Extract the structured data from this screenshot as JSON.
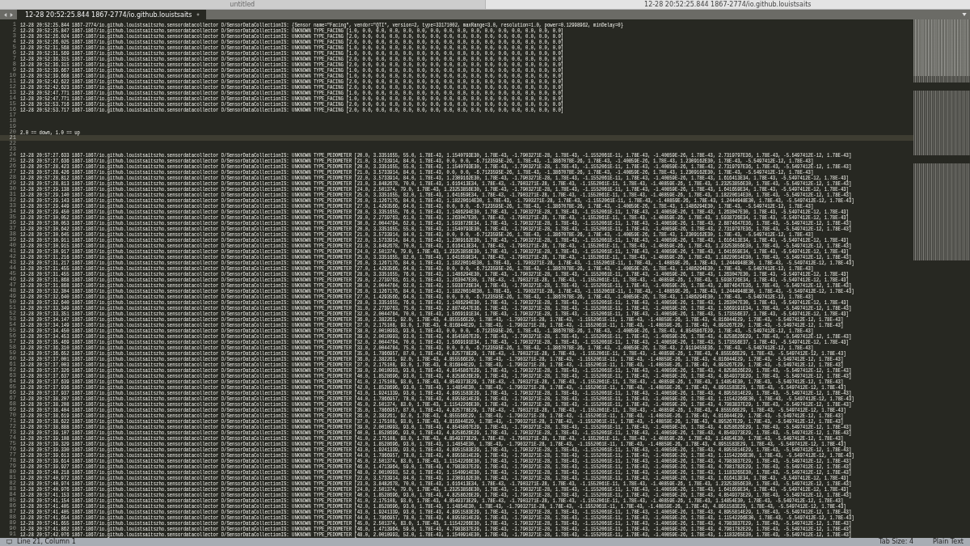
{
  "window_tabs": [
    {
      "title": "untitled",
      "selected": false
    },
    {
      "title": "12-28 20:52:25.844 1867-2774/io.github.louistsaits",
      "selected": true
    }
  ],
  "editor_tabs": [
    {
      "label": "12-28 20:52:25.844 1867-2774/io.github.louistsaits",
      "selected": true,
      "modified": true
    }
  ],
  "lines": [
    {
      "n": "1",
      "current": false,
      "text": "12-28 20:52:25.844 1867-2774/io.github.louistsaitszho.sensordatacollector D/SensorDataCollectionIS: {Sensor name=\"Facing\", vendor=\"QTI\", version=2, type=33171002, maxRange=3.0, resolution=1.0, power=0.12998962, minDelay=0}"
    },
    {
      "n": "2",
      "current": false,
      "text": "12-28 20:52:25.847 1867-1867/io.github.louistsaitszho.sensordatacollector D/SensorDataCollectionIS: UNKNOWN TYPE_FACING [1.0, 0.0, 0.0, 0.0, 0.0, 0.0, 0.0, 0.0, 0.0, 0.0, 0.0, 0.0, 0.0, 0.0, 0.0, 0.0]"
    },
    {
      "n": "3",
      "current": false,
      "text": "12-28 20:52:26.024 1867-1867/io.github.louistsaitszho.sensordatacollector D/SensorDataCollectionIS: UNKNOWN TYPE_FACING [2.0, 0.0, 0.0, 0.0, 0.0, 0.0, 0.0, 0.0, 0.0, 0.0, 0.0, 0.0, 0.0, 0.0, 0.0, 0.0]"
    },
    {
      "n": "4",
      "current": false,
      "text": "12-28 20:52:26.025 1867-1867/io.github.louistsaitszho.sensordatacollector D/SensorDataCollectionIS: UNKNOWN TYPE_FACING [2.0, 0.0, 0.0, 0.0, 0.0, 0.0, 0.0, 0.0, 0.0, 0.0, 0.0, 0.0, 0.0, 0.0, 0.0, 0.0]"
    },
    {
      "n": "5",
      "current": false,
      "text": "12-28 20:52:31.568 1867-1867/io.github.louistsaitszho.sensordatacollector D/SensorDataCollectionIS: UNKNOWN TYPE_FACING [1.0, 0.0, 0.0, 0.0, 0.0, 0.0, 0.0, 0.0, 0.0, 0.0, 0.0, 0.0, 0.0, 0.0, 0.0, 0.0]"
    },
    {
      "n": "6",
      "current": false,
      "text": "12-28 20:52:31.569 1867-1867/io.github.louistsaitszho.sensordatacollector D/SensorDataCollectionIS: UNKNOWN TYPE_FACING [1.0, 0.0, 0.0, 0.0, 0.0, 0.0, 0.0, 0.0, 0.0, 0.0, 0.0, 0.0, 0.0, 0.0, 0.0, 0.0]"
    },
    {
      "n": "7",
      "current": false,
      "text": "12-28 20:52:36.315 1867-1867/io.github.louistsaitszho.sensordatacollector D/SensorDataCollectionIS: UNKNOWN TYPE_FACING [2.0, 0.0, 0.0, 0.0, 0.0, 0.0, 0.0, 0.0, 0.0, 0.0, 0.0, 0.0, 0.0, 0.0, 0.0, 0.0]"
    },
    {
      "n": "8",
      "current": false,
      "text": "12-28 20:52:36.315 1867-1867/io.github.louistsaitszho.sensordatacollector D/SensorDataCollectionIS: UNKNOWN TYPE_FACING [2.0, 0.0, 0.0, 0.0, 0.0, 0.0, 0.0, 0.0, 0.0, 0.0, 0.0, 0.0, 0.0, 0.0, 0.0, 0.0]"
    },
    {
      "n": "9",
      "current": false,
      "text": "12-28 20:52:39.667 1867-1867/io.github.louistsaitszho.sensordatacollector D/SensorDataCollectionIS: UNKNOWN TYPE_FACING [1.0, 0.0, 0.0, 0.0, 0.0, 0.0, 0.0, 0.0, 0.0, 0.0, 0.0, 0.0, 0.0, 0.0, 0.0, 0.0]"
    },
    {
      "n": "10",
      "current": false,
      "text": "12-28 20:52:39.668 1867-1867/io.github.louistsaitszho.sensordatacollector D/SensorDataCollectionIS: UNKNOWN TYPE_FACING [1.0, 0.0, 0.0, 0.0, 0.0, 0.0, 0.0, 0.0, 0.0, 0.0, 0.0, 0.0, 0.0, 0.0, 0.0, 0.0]"
    },
    {
      "n": "11",
      "current": false,
      "text": "12-28 20:52:42.622 1867-1867/io.github.louistsaitszho.sensordatacollector D/SensorDataCollectionIS: UNKNOWN TYPE_FACING [2.0, 0.0, 0.0, 0.0, 0.0, 0.0, 0.0, 0.0, 0.0, 0.0, 0.0, 0.0, 0.0, 0.0, 0.0, 0.0]"
    },
    {
      "n": "12",
      "current": false,
      "text": "12-28 20:52:42.623 1867-1867/io.github.louistsaitszho.sensordatacollector D/SensorDataCollectionIS: UNKNOWN TYPE_FACING [2.0, 0.0, 0.0, 0.0, 0.0, 0.0, 0.0, 0.0, 0.0, 0.0, 0.0, 0.0, 0.0, 0.0, 0.0, 0.0]"
    },
    {
      "n": "13",
      "current": false,
      "text": "12-28 20:52:47.771 1867-1867/io.github.louistsaitszho.sensordatacollector D/SensorDataCollectionIS: UNKNOWN TYPE_FACING [1.0, 0.0, 0.0, 0.0, 0.0, 0.0, 0.0, 0.0, 0.0, 0.0, 0.0, 0.0, 0.0, 0.0, 0.0, 0.0]"
    },
    {
      "n": "14",
      "current": false,
      "text": "12-28 20:52:47.771 1867-1867/io.github.louistsaitszho.sensordatacollector D/SensorDataCollectionIS: UNKNOWN TYPE_FACING [1.0, 0.0, 0.0, 0.0, 0.0, 0.0, 0.0, 0.0, 0.0, 0.0, 0.0, 0.0, 0.0, 0.0, 0.0, 0.0]"
    },
    {
      "n": "15",
      "current": false,
      "text": "12-28 20:52:53.716 1867-1867/io.github.louistsaitszho.sensordatacollector D/SensorDataCollectionIS: UNKNOWN TYPE_FACING [2.0, 0.0, 0.0, 0.0, 0.0, 0.0, 0.0, 0.0, 0.0, 0.0, 0.0, 0.0, 0.0, 0.0, 0.0, 0.0]"
    },
    {
      "n": "16",
      "current": false,
      "text": "12-28 20:52:53.717 1867-1867/io.github.louistsaitszho.sensordatacollector D/SensorDataCollectionIS: UNKNOWN TYPE_FACING [2.0, 0.0, 0.0, 0.0, 0.0, 0.0, 0.0, 0.0, 0.0, 0.0, 0.0, 0.0, 0.0, 0.0, 0.0, 0.0]"
    },
    {
      "n": "17",
      "current": false
    },
    {
      "n": "18",
      "current": false
    },
    {
      "n": "19",
      "current": false
    },
    {
      "n": "20",
      "current": false,
      "text": "2.0 == down, 1.0 == up"
    },
    {
      "n": "21",
      "current": true
    },
    {
      "n": "22",
      "current": false
    },
    {
      "n": "23",
      "current": false
    },
    {
      "n": "24",
      "current": false,
      "text": "12-28 20:57:27.633 1867-1867/io.github.louistsaitszho.sensordatacollector D/SensorDataCollectionIS: UNKNOWN TYPE_PEDOMETER [20.0, 3.3351655, 55.0, 1.78E-43, 1.1540793E30, 1.78E-43, -1.7903271E-28, 1.78E-43, -1.1552061E-11, 1.78E-43, -1.40859E-26, 1.78E-43, 2.7319797E36, 1.78E-43, -5.5497412E-12, 1.78E-43]"
    },
    {
      "n": "25",
      "current": false,
      "text": "12-28 20:57:27.636 1867-1867/io.github.louistsaitszho.sensordatacollector D/SensorDataCollectionIS: UNKNOWN TYPE_PEDOMETER [21.0, 3.5733914, 84.0, 1.78E-43, 0.0, 0.0, -6.7123595E-26, 1.78E-43, -1.3867078E-26, 1.78E-43, -1.40859E-26, 1.78E-43, 1.2309162E30, 1.78E-43, -5.5497412E-12, 1.78E-43]"
    },
    {
      "n": "26",
      "current": false,
      "text": "12-28 20:57:28.423 1867-1867/io.github.louistsaitszho.sensordatacollector D/SensorDataCollectionIS: UNKNOWN TYPE_PEDOMETER [20.0, 3.3351655, 55.0, 1.78E-43, 1.1540793E30, 1.78E-43, -1.7903271E-28, 1.78E-43, -1.1552061E-11, 1.78E-43, -1.40859E-26, 1.78E-43, 2.7319797E36, 1.78E-43, -5.5497412E-12, 1.78E-43]"
    },
    {
      "n": "27",
      "current": false,
      "text": "12-28 20:57:28.426 1867-1867/io.github.louistsaitszho.sensordatacollector D/SensorDataCollectionIS: UNKNOWN TYPE_PEDOMETER [21.0, 3.5733914, 84.0, 1.78E-43, 0.0, 0.0, -6.7123595E-26, 1.78E-43, -1.3867078E-26, 1.78E-43, -1.40859E-26, 1.78E-43, 1.2309162E30, 1.78E-43, -5.5497412E-12, 1.78E-43]"
    },
    {
      "n": "28",
      "current": false,
      "text": "12-28 20:57:28.812 1867-1867/io.github.louistsaitszho.sensordatacollector D/SensorDataCollectionIS: UNKNOWN TYPE_PEDOMETER [22.0, 3.5733914, 84.0, 1.78E-43, 1.2309162E30, 1.78E-43, -1.7903271E-28, 1.78E-43, -1.1552061E-11, 1.78E-43, -1.40859E-26, 1.78E-43, 1.616413E34, 1.78E-43, -5.5497412E-12, 1.78E-43]"
    },
    {
      "n": "29",
      "current": false,
      "text": "12-28 20:57:28.813 1867-1867/io.github.louistsaitszho.sensordatacollector D/SensorDataCollectionIS: UNKNOWN TYPE_PEDOMETER [23.0, 3.8482678, 70.0, 1.78E-43, 1.616413E34, 1.78E-43, -1.7903271E-28, 1.78E-43, -1.1552061E-11, 1.78E-43, -1.40859E-26, 1.78E-43, 1.23253856E30, 1.78E-43, -5.5497412E-12, 1.78E-43]"
    },
    {
      "n": "30",
      "current": false,
      "text": "12-28 20:57:29.138 1867-1867/io.github.louistsaitszho.sensordatacollector D/SensorDataCollectionIS: UNKNOWN TYPE_PEDOMETER [24.0, 2.501374, 79.0, 1.78E-43, 1.23253856E30, 1.78E-43, -1.7903271E-28, 1.78E-43, -1.1552061E-11, 1.78E-43, -1.40859E-26, 1.78E-43, 1.641659E34, 1.78E-43, -5.5497412E-12, 1.78E-43]"
    },
    {
      "n": "31",
      "current": false,
      "text": "12-28 20:57:29.140 1867-1867/io.github.louistsaitszho.sensordatacollector D/SensorDataCollectionIS: UNKNOWN TYPE_PEDOMETER [25.0, 3.3351655, 82.0, 1.78E-43, 1.641659E34, 1.78E-43, -1.7903271E-28, 1.78E-43, -1.1552061E-11, 1.78E-43, -1.40859E-26, 1.78E-43, 1.18220614E30, 1.78E-43, -5.5497412E-12, 1.78E-43]"
    },
    {
      "n": "32",
      "current": false,
      "text": "12-28 20:57:29.143 1867-1867/io.github.louistsaitszho.sensordatacollector D/SensorDataCollectionIS: UNKNOWN TYPE_PEDOMETER [26.0, 3.1267176, 84.0, 1.78E-43, 1.18220614E30, 1.78E-43, -1.7903271E-28, 1.78E-43, -1.1552061E-11, 1.78E-43, -1.40859E-26, 1.78E-43, 1.2444948E30, 1.78E-43, -5.5497412E-12, 1.78E-43]"
    },
    {
      "n": "33",
      "current": false,
      "text": "12-28 20:57:29.449 1867-1867/io.github.louistsaitszho.sensordatacollector D/SensorDataCollectionIS: UNKNOWN TYPE_PEDOMETER [27.0, 1.4293566, 64.0, 1.78E-43, 0.0, 0.0, -6.7123595E-26, 1.78E-43, -1.3867078E-26, 1.78E-43, -1.40859E-26, 1.78E-43, 1.1486294E30, 1.78E-43, -5.5497412E-12, 1.78E-43]"
    },
    {
      "n": "34",
      "current": false,
      "text": "12-28 20:57:29.450 1867-1867/io.github.louistsaitszho.sensordatacollector D/SensorDataCollectionIS: UNKNOWN TYPE_PEDOMETER [28.0, 3.3351655, 76.0, 1.78E-43, 1.1486294E30, 1.78E-43, -1.7903271E-28, 1.78E-43, -1.1552061E-11, 1.78E-43, -1.40859E-26, 1.78E-43, 1.263047E30, 1.78E-43, -5.5497412E-12, 1.78E-43]"
    },
    {
      "n": "35",
      "current": false,
      "text": "12-28 20:57:30.052 1867-1867/io.github.louistsaitszho.sensordatacollector D/SensorDataCollectionIS: UNKNOWN TYPE_PEDOMETER [29.0, 2.2739763, 61.0, 1.78E-43, 1.263047E30, 1.78E-43, -1.7903271E-28, 1.78E-43, -1.1552061E-11, 1.78E-43, -1.40859E-26, 1.78E-43, 1.5938726E34, 1.78E-43, -5.5497412E-12, 1.78E-43]"
    },
    {
      "n": "36",
      "current": false,
      "text": "12-28 20:57:30.053 1867-1867/io.github.louistsaitszho.sensordatacollector D/SensorDataCollectionIS: UNKNOWN TYPE_PEDOMETER [30.0, 2.0044784, 62.0, 1.78E-43, 1.5938726E34, 1.78E-43, -1.7903271E-28, 1.78E-43, -1.1552061E-11, 1.78E-43, -1.40859E-26, 1.78E-43, 2.8874647E36, 1.78E-43, -5.5497412E-12, 1.78E-43]"
    },
    {
      "n": "37",
      "current": false,
      "text": "12-28 20:57:30.642 1867-1867/io.github.louistsaitszho.sensordatacollector D/SensorDataCollectionIS: UNKNOWN TYPE_PEDOMETER [20.0, 3.3351655, 55.0, 1.78E-43, 1.1540793E30, 1.78E-43, -1.7903271E-28, 1.78E-43, -1.1552061E-11, 1.78E-43, -1.40859E-26, 1.78E-43, 2.7319797E36, 1.78E-43, -5.5497412E-12, 1.78E-43]"
    },
    {
      "n": "38",
      "current": false,
      "text": "12-28 20:57:30.645 1867-1867/io.github.louistsaitszho.sensordatacollector D/SensorDataCollectionIS: UNKNOWN TYPE_PEDOMETER [21.0, 3.5733914, 84.0, 1.78E-43, 0.0, 0.0, -6.7123595E-26, 1.78E-43, -1.3867078E-26, 1.78E-43, -1.40859E-26, 1.78E-43, 1.2309162E30, 1.78E-43, -5.5497412E-12, 1.78E-43]"
    },
    {
      "n": "39",
      "current": false,
      "text": "12-28 20:57:30.911 1867-1867/io.github.louistsaitszho.sensordatacollector D/SensorDataCollectionIS: UNKNOWN TYPE_PEDOMETER [22.0, 3.5733914, 84.0, 1.78E-43, 1.2309162E30, 1.78E-43, -1.7903271E-28, 1.78E-43, -1.1552061E-11, 1.78E-43, -1.40859E-26, 1.78E-43, 1.616413E34, 1.78E-43, -5.5497412E-12, 1.78E-43]"
    },
    {
      "n": "40",
      "current": false,
      "text": "12-28 20:57:30.915 1867-1867/io.github.louistsaitszho.sensordatacollector D/SensorDataCollectionIS: UNKNOWN TYPE_PEDOMETER [23.0, 3.8482678, 70.0, 1.78E-43, 1.616413E34, 1.78E-43, -1.7903271E-28, 1.78E-43, -1.1552061E-11, 1.78E-43, -1.40859E-26, 1.78E-43, 1.23253856E30, 1.78E-43, -5.5497412E-12, 1.78E-43]"
    },
    {
      "n": "41",
      "current": false,
      "text": "12-28 20:57:30.917 1867-1867/io.github.louistsaitszho.sensordatacollector D/SensorDataCollectionIS: UNKNOWN TYPE_PEDOMETER [24.0, 2.501374, 79.0, 1.78E-43, 1.23253856E30, 1.78E-43, -1.7903271E-28, 1.78E-43, -1.1552061E-11, 1.78E-43, -1.40859E-26, 1.78E-43, 1.641659E34, 1.78E-43, -5.5497412E-12, 1.78E-43]"
    },
    {
      "n": "42",
      "current": false,
      "text": "12-28 20:57:31.216 1867-1867/io.github.louistsaitszho.sensordatacollector D/SensorDataCollectionIS: UNKNOWN TYPE_PEDOMETER [25.0, 3.3351655, 82.0, 1.78E-43, 1.641659E34, 1.78E-43, -1.7903271E-28, 1.78E-43, -1.1552061E-11, 1.78E-43, -1.40859E-26, 1.78E-43, 1.18220614E30, 1.78E-43, -5.5497412E-12, 1.78E-43]"
    },
    {
      "n": "43",
      "current": false,
      "text": "12-28 20:57:31.217 1867-1867/io.github.louistsaitszho.sensordatacollector D/SensorDataCollectionIS: UNKNOWN TYPE_PEDOMETER [26.0, 3.1267176, 84.0, 1.78E-43, 1.18220614E30, 1.78E-43, -1.7903271E-28, 1.78E-43, -1.1552061E-11, 1.78E-43, -1.40859E-26, 1.78E-43, 1.2444948E30, 1.78E-43, -5.5497412E-12, 1.78E-43]"
    },
    {
      "n": "44",
      "current": false,
      "text": "12-28 20:57:31.455 1867-1867/io.github.louistsaitszho.sensordatacollector D/SensorDataCollectionIS: UNKNOWN TYPE_PEDOMETER [27.0, 1.4293566, 64.0, 1.78E-43, 0.0, 0.0, -6.7123595E-26, 1.78E-43, -1.3867078E-26, 1.78E-43, -1.40859E-26, 1.78E-43, 1.1486294E30, 1.78E-43, -5.5497412E-12, 1.78E-43]"
    },
    {
      "n": "45",
      "current": false,
      "text": "12-28 20:57:31.455 1867-1867/io.github.louistsaitszho.sensordatacollector D/SensorDataCollectionIS: UNKNOWN TYPE_PEDOMETER [28.0, 3.3351655, 76.0, 1.78E-43, 1.1486294E30, 1.78E-43, -1.7903271E-28, 1.78E-43, -1.1552061E-11, 1.78E-43, -1.40859E-26, 1.78E-43, 1.263047E30, 1.78E-43, -5.5497412E-12, 1.78E-43]"
    },
    {
      "n": "46",
      "current": false,
      "text": "12-28 20:57:31.868 1867-1867/io.github.louistsaitszho.sensordatacollector D/SensorDataCollectionIS: UNKNOWN TYPE_PEDOMETER [29.0, 2.2739763, 61.0, 1.78E-43, 1.263047E30, 1.78E-43, -1.7903271E-28, 1.78E-43, -1.1552061E-11, 1.78E-43, -1.40859E-26, 1.78E-43, 1.5938726E34, 1.78E-43, -5.5497412E-12, 1.78E-43]"
    },
    {
      "n": "47",
      "current": false,
      "text": "12-28 20:57:31.868 1867-1867/io.github.louistsaitszho.sensordatacollector D/SensorDataCollectionIS: UNKNOWN TYPE_PEDOMETER [30.0, 2.0044784, 62.0, 1.78E-43, 1.5938726E34, 1.78E-43, -1.7903271E-28, 1.78E-43, -1.1552061E-11, 1.78E-43, -1.40859E-26, 1.78E-43, 2.8874647E36, 1.78E-43, -5.5497412E-12, 1.78E-43]"
    },
    {
      "n": "48",
      "current": false,
      "text": "12-28 20:57:32.304 1867-1867/io.github.louistsaitszho.sensordatacollector D/SensorDataCollectionIS: UNKNOWN TYPE_PEDOMETER [26.0, 3.1267176, 84.0, 1.78E-43, 1.18220614E30, 1.78E-43, -1.7903271E-28, 1.78E-43, -1.1552061E-11, 1.78E-43, -1.40859E-26, 1.78E-43, 1.2444948E30, 1.78E-43, -5.5497412E-12, 1.78E-43]"
    },
    {
      "n": "49",
      "current": false,
      "text": "12-28 20:57:32.640 1867-1867/io.github.louistsaitszho.sensordatacollector D/SensorDataCollectionIS: UNKNOWN TYPE_PEDOMETER [27.0, 1.4293566, 64.0, 1.78E-43, 0.0, 0.0, -6.7123595E-26, 1.78E-43, -1.3867078E-26, 1.78E-43, -1.40859E-26, 1.78E-43, 1.1486294E30, 1.78E-43, -5.5497412E-12, 1.78E-43]"
    },
    {
      "n": "50",
      "current": false,
      "text": "12-28 20:57:32.640 1867-1867/io.github.louistsaitszho.sensordatacollector D/SensorDataCollectionIS: UNKNOWN TYPE_PEDOMETER [28.0, 3.3351655, 76.0, 1.78E-43, 1.1486294E30, 1.78E-43, -1.7903271E-28, 1.78E-43, -1.1552061E-11, 1.78E-43, -1.40859E-26, 1.78E-43, 1.263047E30, 1.78E-43, -5.5497412E-12, 1.78E-43]"
    },
    {
      "n": "51",
      "current": false,
      "text": "12-28 20:57:33.349 1867-1867/io.github.louistsaitszho.sensordatacollector D/SensorDataCollectionIS: UNKNOWN TYPE_PEDOMETER [31.0, 2.2739763, 75.0, 1.78E-43, 2.8874647E36, 1.78E-43, -1.7903271E-28, 1.78E-43, -1.1552061E-11, 1.78E-43, -1.40859E-26, 1.78E-43, 1.5669191E34, 1.78E-43, -5.5497412E-12, 1.78E-43]"
    },
    {
      "n": "52",
      "current": false,
      "text": "12-28 20:57:33.351 1867-1867/io.github.louistsaitszho.sensordatacollector D/SensorDataCollectionIS: UNKNOWN TYPE_PEDOMETER [32.0, 2.0044784, 70.0, 1.78E-43, 1.5669191E34, 1.78E-43, -1.7903271E-28, 1.78E-43, -1.1552061E-11, 1.78E-43, -1.40859E-26, 1.78E-43, 5.173556E37, 1.78E-43, -5.5497412E-12, 1.78E-43]"
    },
    {
      "n": "53",
      "current": false,
      "text": "12-28 20:57:34.147 1867-1867/io.github.louistsaitszho.sensordatacollector D/SensorDataCollectionIS: UNKNOWN TYPE_PEDOMETER [36.0, 2.382261, 92.0, 1.78E-43, 4.855566E29, 1.78E-43, -1.7903271E-28, 1.78E-43, -1.1552061E-11, 1.78E-43, -1.40859E-26, 1.78E-43, 4.816844E29, 1.78E-43, -5.5497412E-12, 1.78E-43]"
    },
    {
      "n": "54",
      "current": false,
      "text": "12-28 20:57:34.149 1867-1867/io.github.louistsaitszho.sensordatacollector D/SensorDataCollectionIS: UNKNOWN TYPE_PEDOMETER [37.0, 2.175108, 93.0, 1.78E-43, 4.816844E29, 1.78E-43, -1.7903271E-28, 1.78E-43, -1.1552061E-11, 1.78E-43, -1.40859E-26, 1.78E-43, 4.895267E29, 1.78E-43, -5.5497412E-12, 1.78E-43]"
    },
    {
      "n": "55",
      "current": false,
      "text": "12-28 20:57:34.450 1867-1867/io.github.louistsaitszho.sensordatacollector D/SensorDataCollectionIS: UNKNOWN TYPE_PEDOMETER [38.0, 2.0010993, 93.0, 1.78E-43, 0.0, 0.0, -6.7123595E-26, 1.78E-43, -1.3867078E-26, 1.78E-43, -1.40859E-26, 1.78E-43, 4.8545867E29, 1.78E-43, -5.5497412E-12, 1.78E-43]"
    },
    {
      "n": "56",
      "current": false,
      "text": "12-28 20:57:34.453 1867-1867/io.github.louistsaitszho.sensordatacollector D/SensorDataCollectionIS: UNKNOWN TYPE_PEDOMETER [39.0, 2.0010993, 93.0, 1.78E-43, 4.8545867E29, 1.78E-43, -1.7903271E-28, 1.78E-43, -1.1552061E-11, 1.78E-43, -1.40859E-26, 1.78E-43, 4.8258626E29, 1.78E-43, -5.5497412E-12, 1.78E-43]"
    },
    {
      "n": "57",
      "current": false,
      "text": "12-28 20:57:35.469 1867-1867/io.github.louistsaitszho.sensordatacollector D/SensorDataCollectionIS: UNKNOWN TYPE_PEDOMETER [32.0, 2.0044784, 70.0, 1.78E-43, 1.5669191E34, 1.78E-43, -1.7903271E-28, 1.78E-43, -1.1552061E-11, 1.78E-43, -1.40859E-26, 1.78E-43, 5.173556E37, 1.78E-43, -5.5497412E-12, 1.78E-43]"
    },
    {
      "n": "58",
      "current": false,
      "text": "12-28 20:57:36.310 1867-1867/io.github.louistsaitszho.sensordatacollector D/SensorDataCollectionIS: UNKNOWN TYPE_PEDOMETER [33.0, 2.0044784, 75.0, 1.78E-43, 0.0, 0.0, -6.7123595E-26, 1.78E-43, -1.3867078E-26, 1.78E-43, -1.40859E-26, 1.78E-43, 2.9119455E36, 1.78E-43, -5.5497412E-12, 1.78E-43]"
    },
    {
      "n": "59",
      "current": false,
      "text": "12-28 20:57:36.652 1867-1867/io.github.louistsaitszho.sensordatacollector D/SensorDataCollectionIS: UNKNOWN TYPE_PEDOMETER [35.0, 1.7866957, 87.0, 1.78E-43, 4.825778E29, 1.78E-43, -1.7903271E-28, 1.78E-43, -1.1552061E-11, 1.78E-43, -1.40859E-26, 1.78E-43, 4.855566E29, 1.78E-43, -5.5497412E-12, 1.78E-43]"
    },
    {
      "n": "60",
      "current": false,
      "text": "12-28 20:57:37.001 1867-1867/io.github.louistsaitszho.sensordatacollector D/SensorDataCollectionIS: UNKNOWN TYPE_PEDOMETER [36.0, 2.382261, 92.0, 1.78E-43, 4.855566E29, 1.78E-43, -1.7903271E-28, 1.78E-43, -1.1552061E-11, 1.78E-43, -1.40859E-26, 1.78E-43, 4.816844E29, 1.78E-43, -5.5497412E-12, 1.78E-43]"
    },
    {
      "n": "61",
      "current": false,
      "text": "12-28 20:57:37.003 1867-1867/io.github.louistsaitszho.sensordatacollector D/SensorDataCollectionIS: UNKNOWN TYPE_PEDOMETER [37.0, 2.175108, 93.0, 1.78E-43, 4.816844E29, 1.78E-43, -1.7903271E-28, 1.78E-43, -1.1552061E-11, 1.78E-43, -1.40859E-26, 1.78E-43, 4.895267E29, 1.78E-43, -5.5497412E-12, 1.78E-43]"
    },
    {
      "n": "62",
      "current": false,
      "text": "12-28 20:57:37.326 1867-1867/io.github.louistsaitszho.sensordatacollector D/SensorDataCollectionIS: UNKNOWN TYPE_PEDOMETER [39.0, 2.0010993, 93.0, 1.78E-43, 4.8545867E29, 1.78E-43, -1.7903271E-28, 1.78E-43, -1.1552061E-11, 1.78E-43, -1.40859E-26, 1.78E-43, 4.8258626E29, 1.78E-43, -5.5497412E-12, 1.78E-43]"
    },
    {
      "n": "63",
      "current": false,
      "text": "12-28 20:57:37.637 1867-1867/io.github.louistsaitszho.sensordatacollector D/SensorDataCollectionIS: UNKNOWN TYPE_PEDOMETER [40.0, 1.8528696, 93.0, 1.78E-43, 4.8258626E29, 1.78E-43, -1.7903271E-28, 1.78E-43, -1.1552061E-11, 1.78E-43, -1.40859E-26, 1.78E-43, 4.8549373E29, 1.78E-43, -5.5497412E-12, 1.78E-43]"
    },
    {
      "n": "64",
      "current": false,
      "text": "12-28 20:57:37.639 1867-1867/io.github.louistsaitszho.sensordatacollector D/SensorDataCollectionIS: UNKNOWN TYPE_PEDOMETER [41.0, 2.175108, 93.0, 1.78E-43, 4.8549373E29, 1.78E-43, -1.7903271E-28, 1.78E-43, -1.1552061E-11, 1.78E-43, -1.40859E-26, 1.78E-43, 1.14854E30, 1.78E-43, -5.5497412E-12, 1.78E-43]"
    },
    {
      "n": "65",
      "current": false,
      "text": "12-28 20:57:37.936 1867-1867/io.github.louistsaitszho.sensordatacollector D/SensorDataCollectionIS: UNKNOWN TYPE_PEDOMETER [42.0, 1.8528696, 93.0, 1.78E-43, 1.14854E30, 1.78E-43, -1.7903271E-28, 1.78E-43, -1.1552061E-11, 1.78E-43, -1.40859E-26, 1.78E-43, 4.8951583E29, 1.78E-43, -5.5497412E-12, 1.78E-43]"
    },
    {
      "n": "66",
      "current": false,
      "text": "12-28 20:57:37.937 1867-1867/io.github.louistsaitszho.sensordatacollector D/SensorDataCollectionIS: UNKNOWN TYPE_PEDOMETER [43.0, 1.9241339, 93.0, 1.78E-43, 4.8951583E29, 1.78E-43, -1.7903271E-28, 1.78E-43, -1.1552061E-11, 1.78E-43, -1.40859E-26, 1.78E-43, 4.8955814E29, 1.78E-43, -5.5497412E-12, 1.78E-43]"
    },
    {
      "n": "67",
      "current": false,
      "text": "12-28 20:57:38.207 1867-1867/io.github.louistsaitszho.sensordatacollector D/SensorDataCollectionIS: UNKNOWN TYPE_PEDOMETER [44.0, 1.7866957, 78.0, 1.78E-43, 4.8955814E29, 1.78E-43, -1.7903271E-28, 1.78E-43, -1.1552061E-11, 1.78E-43, -1.40859E-26, 1.78E-43, 1.11542266E30, 1.78E-43, -5.5497412E-12, 1.78E-43]"
    },
    {
      "n": "68",
      "current": false,
      "text": "12-28 20:57:38.208 1867-1867/io.github.louistsaitszho.sensordatacollector D/SensorDataCollectionIS: UNKNOWN TYPE_PEDOMETER [45.0, 2.501374, 83.0, 1.78E-43, 1.11542266E30, 1.78E-43, -1.7903271E-28, 1.78E-43, -1.1552061E-11, 1.78E-43, -1.40859E-26, 1.78E-43, 4.7983837E29, 1.78E-43, -5.5497412E-12, 1.78E-43]"
    },
    {
      "n": "69",
      "current": false,
      "text": "12-28 20:57:38.404 1867-1867/io.github.louistsaitszho.sensordatacollector D/SensorDataCollectionIS: UNKNOWN TYPE_PEDOMETER [35.0, 1.7866957, 87.0, 1.78E-43, 4.825778E29, 1.78E-43, -1.7903271E-28, 1.78E-43, -1.1552061E-11, 1.78E-43, -1.40859E-26, 1.78E-43, 4.855566E29, 1.78E-43, -5.5497412E-12, 1.78E-43]"
    },
    {
      "n": "70",
      "current": false,
      "text": "12-28 20:57:38.619 1867-1867/io.github.louistsaitszho.sensordatacollector D/SensorDataCollectionIS: UNKNOWN TYPE_PEDOMETER [36.0, 2.382261, 92.0, 1.78E-43, 4.855566E29, 1.78E-43, -1.7903271E-28, 1.78E-43, -1.1552061E-11, 1.78E-43, -1.40859E-26, 1.78E-43, 4.816844E29, 1.78E-43, -5.5497412E-12, 1.78E-43]"
    },
    {
      "n": "71",
      "current": false,
      "text": "12-28 20:57:38.622 1867-1867/io.github.louistsaitszho.sensordatacollector D/SensorDataCollectionIS: UNKNOWN TYPE_PEDOMETER [37.0, 2.175108, 93.0, 1.78E-43, 4.816844E29, 1.78E-43, -1.7903271E-28, 1.78E-43, -1.1552061E-11, 1.78E-43, -1.40859E-26, 1.78E-43, 4.895267E29, 1.78E-43, -5.5497412E-12, 1.78E-43]"
    },
    {
      "n": "72",
      "current": false,
      "text": "12-28 20:57:38.888 1867-1867/io.github.louistsaitszho.sensordatacollector D/SensorDataCollectionIS: UNKNOWN TYPE_PEDOMETER [39.0, 2.0010993, 93.0, 1.78E-43, 4.8545867E29, 1.78E-43, -1.7903271E-28, 1.78E-43, -1.1552061E-11, 1.78E-43, -1.40859E-26, 1.78E-43, 4.8258626E29, 1.78E-43, -5.5497412E-12, 1.78E-43]"
    },
    {
      "n": "73",
      "current": false,
      "text": "12-28 20:57:39.107 1867-1867/io.github.louistsaitszho.sensordatacollector D/SensorDataCollectionIS: UNKNOWN TYPE_PEDOMETER [40.0, 1.8528696, 93.0, 1.78E-43, 4.8258626E29, 1.78E-43, -1.7903271E-28, 1.78E-43, -1.1552061E-11, 1.78E-43, -1.40859E-26, 1.78E-43, 4.8549373E29, 1.78E-43, -5.5497412E-12, 1.78E-43]"
    },
    {
      "n": "74",
      "current": false,
      "text": "12-28 20:57:39.108 1867-1867/io.github.louistsaitszho.sensordatacollector D/SensorDataCollectionIS: UNKNOWN TYPE_PEDOMETER [41.0, 2.175108, 93.0, 1.78E-43, 4.8549373E29, 1.78E-43, -1.7903271E-28, 1.78E-43, -1.1552061E-11, 1.78E-43, -1.40859E-26, 1.78E-43, 1.14854E30, 1.78E-43, -5.5497412E-12, 1.78E-43]"
    },
    {
      "n": "75",
      "current": false,
      "text": "12-28 20:57:39.329 1867-1867/io.github.louistsaitszho.sensordatacollector D/SensorDataCollectionIS: UNKNOWN TYPE_PEDOMETER [42.0, 1.8528696, 93.0, 1.78E-43, 1.14854E30, 1.78E-43, -1.7903271E-28, 1.78E-43, -1.1552061E-11, 1.78E-43, -1.40859E-26, 1.78E-43, 4.8951583E29, 1.78E-43, -5.5497412E-12, 1.78E-43]"
    },
    {
      "n": "76",
      "current": false,
      "text": "12-28 20:57:39.330 1867-1867/io.github.louistsaitszho.sensordatacollector D/SensorDataCollectionIS: UNKNOWN TYPE_PEDOMETER [43.0, 1.9241339, 93.0, 1.78E-43, 4.8951583E29, 1.78E-43, -1.7903271E-28, 1.78E-43, -1.1552061E-11, 1.78E-43, -1.40859E-26, 1.78E-43, 4.8955814E29, 1.78E-43, -5.5497412E-12, 1.78E-43]"
    },
    {
      "n": "77",
      "current": false,
      "text": "12-28 20:57:39.613 1867-1867/io.github.louistsaitszho.sensordatacollector D/SensorDataCollectionIS: UNKNOWN TYPE_PEDOMETER [44.0, 1.7866957, 78.0, 1.78E-43, 4.8955814E29, 1.78E-43, -1.7903271E-28, 1.78E-43, -1.1552061E-11, 1.78E-43, -1.40859E-26, 1.78E-43, 1.11542266E30, 1.78E-43, -5.5497412E-12, 1.78E-43]"
    },
    {
      "n": "78",
      "current": false,
      "text": "12-28 20:57:39.614 1867-1867/io.github.louistsaitszho.sensordatacollector D/SensorDataCollectionIS: UNKNOWN TYPE_PEDOMETER [45.0, 2.501374, 83.0, 1.78E-43, 1.11542266E30, 1.78E-43, -1.7903271E-28, 1.78E-43, -1.1552061E-11, 1.78E-43, -1.40859E-26, 1.78E-43, 4.7983837E29, 1.78E-43, -5.5497412E-12, 1.78E-43]"
    },
    {
      "n": "79",
      "current": false,
      "text": "12-28 20:57:39.927 1867-1867/io.github.louistsaitszho.sensordatacollector D/SensorDataCollectionIS: UNKNOWN TYPE_PEDOMETER [46.0, 1.4713964, 59.0, 1.78E-43, 4.7983837E29, 1.78E-43, -1.7903271E-28, 1.78E-43, -1.1552061E-11, 1.78E-43, -1.40859E-26, 1.78E-43, 4.7981782E29, 1.78E-43, -5.5497412E-12, 1.78E-43]"
    },
    {
      "n": "80",
      "current": false,
      "text": "12-28 20:57:40.218 1867-1867/io.github.louistsaitszho.sensordatacollector D/SensorDataCollectionIS: UNKNOWN TYPE_PEDOMETER [48.0, 2.0010993, 52.0, 1.78E-43, 1.1540914E30, 1.78E-43, -1.7903271E-28, 1.78E-43, -1.1552061E-11, 1.78E-43, -1.40859E-26, 1.78E-43, 1.1183265E30, 1.78E-43, -5.5497412E-12, 1.78E-43]"
    },
    {
      "n": "81",
      "current": false,
      "text": "12-28 20:57:40.972 1867-1867/io.github.louistsaitszho.sensordatacollector D/SensorDataCollectionIS: UNKNOWN TYPE_PEDOMETER [22.0, 3.5733914, 84.0, 1.78E-43, 1.2309162E30, 1.78E-43, -1.7903271E-28, 1.78E-43, -1.1552061E-11, 1.78E-43, -1.40859E-26, 1.78E-43, 1.616413E34, 1.78E-43, -5.5497412E-12, 1.78E-43]"
    },
    {
      "n": "82",
      "current": false,
      "text": "12-28 20:57:40.974 1867-1867/io.github.louistsaitszho.sensordatacollector D/SensorDataCollectionIS: UNKNOWN TYPE_PEDOMETER [23.0, 3.8482678, 70.0, 1.78E-43, 1.616413E34, 1.78E-43, -1.7903271E-28, 1.78E-43, -1.1552061E-11, 1.78E-43, -1.40859E-26, 1.78E-43, 1.23253856E30, 1.78E-43, -5.5497412E-12, 1.78E-43]"
    },
    {
      "n": "83",
      "current": false,
      "text": "12-28 20:57:40.976 1867-1867/io.github.louistsaitszho.sensordatacollector D/SensorDataCollectionIS: UNKNOWN TYPE_PEDOMETER [24.0, 2.501374, 79.0, 1.78E-43, 1.23253856E30, 1.78E-43, -1.7903271E-28, 1.78E-43, -1.1552061E-11, 1.78E-43, -1.40859E-26, 1.78E-43, 1.641659E34, 1.78E-43, -5.5497412E-12, 1.78E-43]"
    },
    {
      "n": "84",
      "current": false,
      "text": "12-28 20:57:41.153 1867-1867/io.github.louistsaitszho.sensordatacollector D/SensorDataCollectionIS: UNKNOWN TYPE_PEDOMETER [40.0, 1.8528696, 93.0, 1.78E-43, 4.8258626E29, 1.78E-43, -1.7903271E-28, 1.78E-43, -1.1552061E-11, 1.78E-43, -1.40859E-26, 1.78E-43, 4.8549373E29, 1.78E-43, -5.5497412E-12, 1.78E-43]"
    },
    {
      "n": "85",
      "current": false,
      "text": "12-28 20:57:41.154 1867-1867/io.github.louistsaitszho.sensordatacollector D/SensorDataCollectionIS: UNKNOWN TYPE_PEDOMETER [41.0, 2.175108, 93.0, 1.78E-43, 4.8549373E29, 1.78E-43, -1.7903271E-28, 1.78E-43, -1.1552061E-11, 1.78E-43, -1.40859E-26, 1.78E-43, 1.14854E30, 1.78E-43, -5.5497412E-12, 1.78E-43]"
    },
    {
      "n": "86",
      "current": false,
      "text": "12-28 20:57:41.405 1867-1867/io.github.louistsaitszho.sensordatacollector D/SensorDataCollectionIS: UNKNOWN TYPE_PEDOMETER [42.0, 1.8528696, 93.0, 1.78E-43, 1.14854E30, 1.78E-43, -1.7903271E-28, 1.78E-43, -1.1552061E-11, 1.78E-43, -1.40859E-26, 1.78E-43, 4.8951583E29, 1.78E-43, -5.5497412E-12, 1.78E-43]"
    },
    {
      "n": "87",
      "current": false,
      "text": "12-28 20:57:41.405 1867-1867/io.github.louistsaitszho.sensordatacollector D/SensorDataCollectionIS: UNKNOWN TYPE_PEDOMETER [43.0, 1.9241339, 93.0, 1.78E-43, 4.8951583E29, 1.78E-43, -1.7903271E-28, 1.78E-43, -1.1552061E-11, 1.78E-43, -1.40859E-26, 1.78E-43, 4.8955814E29, 1.78E-43, -5.5497412E-12, 1.78E-43]"
    },
    {
      "n": "88",
      "current": false,
      "text": "12-28 20:57:41.654 1867-1867/io.github.louistsaitszho.sensordatacollector D/SensorDataCollectionIS: UNKNOWN TYPE_PEDOMETER [44.0, 1.7866957, 78.0, 1.78E-43, 4.8955814E29, 1.78E-43, -1.7903271E-28, 1.78E-43, -1.1552061E-11, 1.78E-43, -1.40859E-26, 1.78E-43, 1.11542266E30, 1.78E-43, -5.5497412E-12, 1.78E-43]"
    },
    {
      "n": "89",
      "current": false,
      "text": "12-28 20:57:41.655 1867-1867/io.github.louistsaitszho.sensordatacollector D/SensorDataCollectionIS: UNKNOWN TYPE_PEDOMETER [45.0, 2.501374, 83.0, 1.78E-43, 1.11542266E30, 1.78E-43, -1.7903271E-28, 1.78E-43, -1.1552061E-11, 1.78E-43, -1.40859E-26, 1.78E-43, 4.7983837E29, 1.78E-43, -5.5497412E-12, 1.78E-43]"
    },
    {
      "n": "90",
      "current": false,
      "text": "12-28 20:57:41.862 1867-1867/io.github.louistsaitszho.sensordatacollector D/SensorDataCollectionIS: UNKNOWN TYPE_PEDOMETER [46.0, 1.4713964, 59.0, 1.78E-43, 4.7983837E29, 1.78E-43, -1.7903271E-28, 1.78E-43, -1.1552061E-11, 1.78E-43, -1.40859E-26, 1.78E-43, 4.7981782E29, 1.78E-43, -5.5497412E-12, 1.78E-43]"
    },
    {
      "n": "91",
      "current": false,
      "text": "12-28 20:57:42.076 1867-1867/io.github.louistsaitszho.sensordatacollector D/SensorDataCollectionIS: UNKNOWN TYPE_PEDOMETER [48.0, 2.0010993, 52.0, 1.78E-43, 1.1540914E30, 1.78E-43, -1.7903271E-28, 1.78E-43, -1.1552061E-11, 1.78E-43, -1.40859E-26, 1.78E-43, 1.1183265E30, 1.78E-43, -5.5497412E-12, 1.78E-43]"
    }
  ],
  "status_bar": {
    "position": "Line 21, Column 1",
    "tab_size": "Tab Size: 4",
    "syntax": "Plain Text"
  }
}
